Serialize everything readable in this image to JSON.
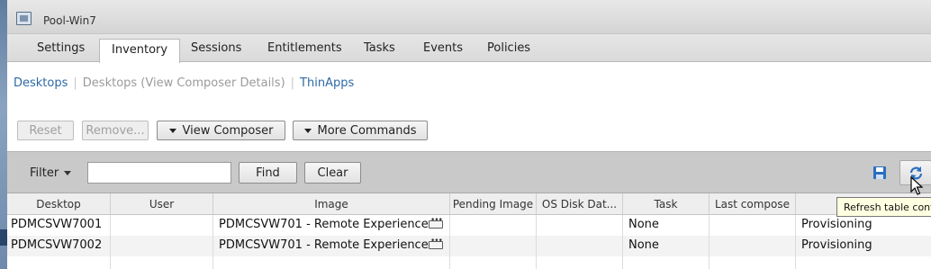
{
  "window": {
    "title": "Pool-Win7"
  },
  "tabs": [
    "Settings",
    "Inventory",
    "Sessions",
    "Entitlements",
    "Tasks",
    "Events",
    "Policies"
  ],
  "subnav": {
    "desktops": "Desktops",
    "composer_details": "Desktops (View Composer Details)",
    "thinapps": "ThinApps"
  },
  "toolbar": {
    "reset": "Reset",
    "remove": "Remove...",
    "view_composer": "View Composer",
    "more_commands": "More Commands"
  },
  "filter": {
    "label": "Filter",
    "value": "",
    "find": "Find",
    "clear": "Clear"
  },
  "tooltip": "Refresh table contents",
  "table": {
    "columns": [
      "Desktop",
      "User",
      "Image",
      "Pending Image",
      "OS Disk Dat...",
      "Task",
      "Last compose",
      ""
    ],
    "rows": [
      {
        "desktop": "PDMCSVW7001",
        "user": "",
        "image": "PDMCSVW701 - Remote Experience",
        "pending": "",
        "osdisk": "",
        "task": "None",
        "last": "",
        "status": "Provisioning"
      },
      {
        "desktop": "PDMCSVW7002",
        "user": "",
        "image": "PDMCSVW701 - Remote Experience",
        "pending": "",
        "osdisk": "",
        "task": "None",
        "last": "",
        "status": "Provisioning"
      }
    ]
  },
  "icons": [
    "vm-pool-icon",
    "save-icon",
    "refresh-icon",
    "more-details-icon",
    "mouse-cursor-icon"
  ],
  "colors": {
    "link": "#2c6aa5",
    "filterbar": "#c9c9c9",
    "tooltip_bg": "#ffffe1"
  }
}
